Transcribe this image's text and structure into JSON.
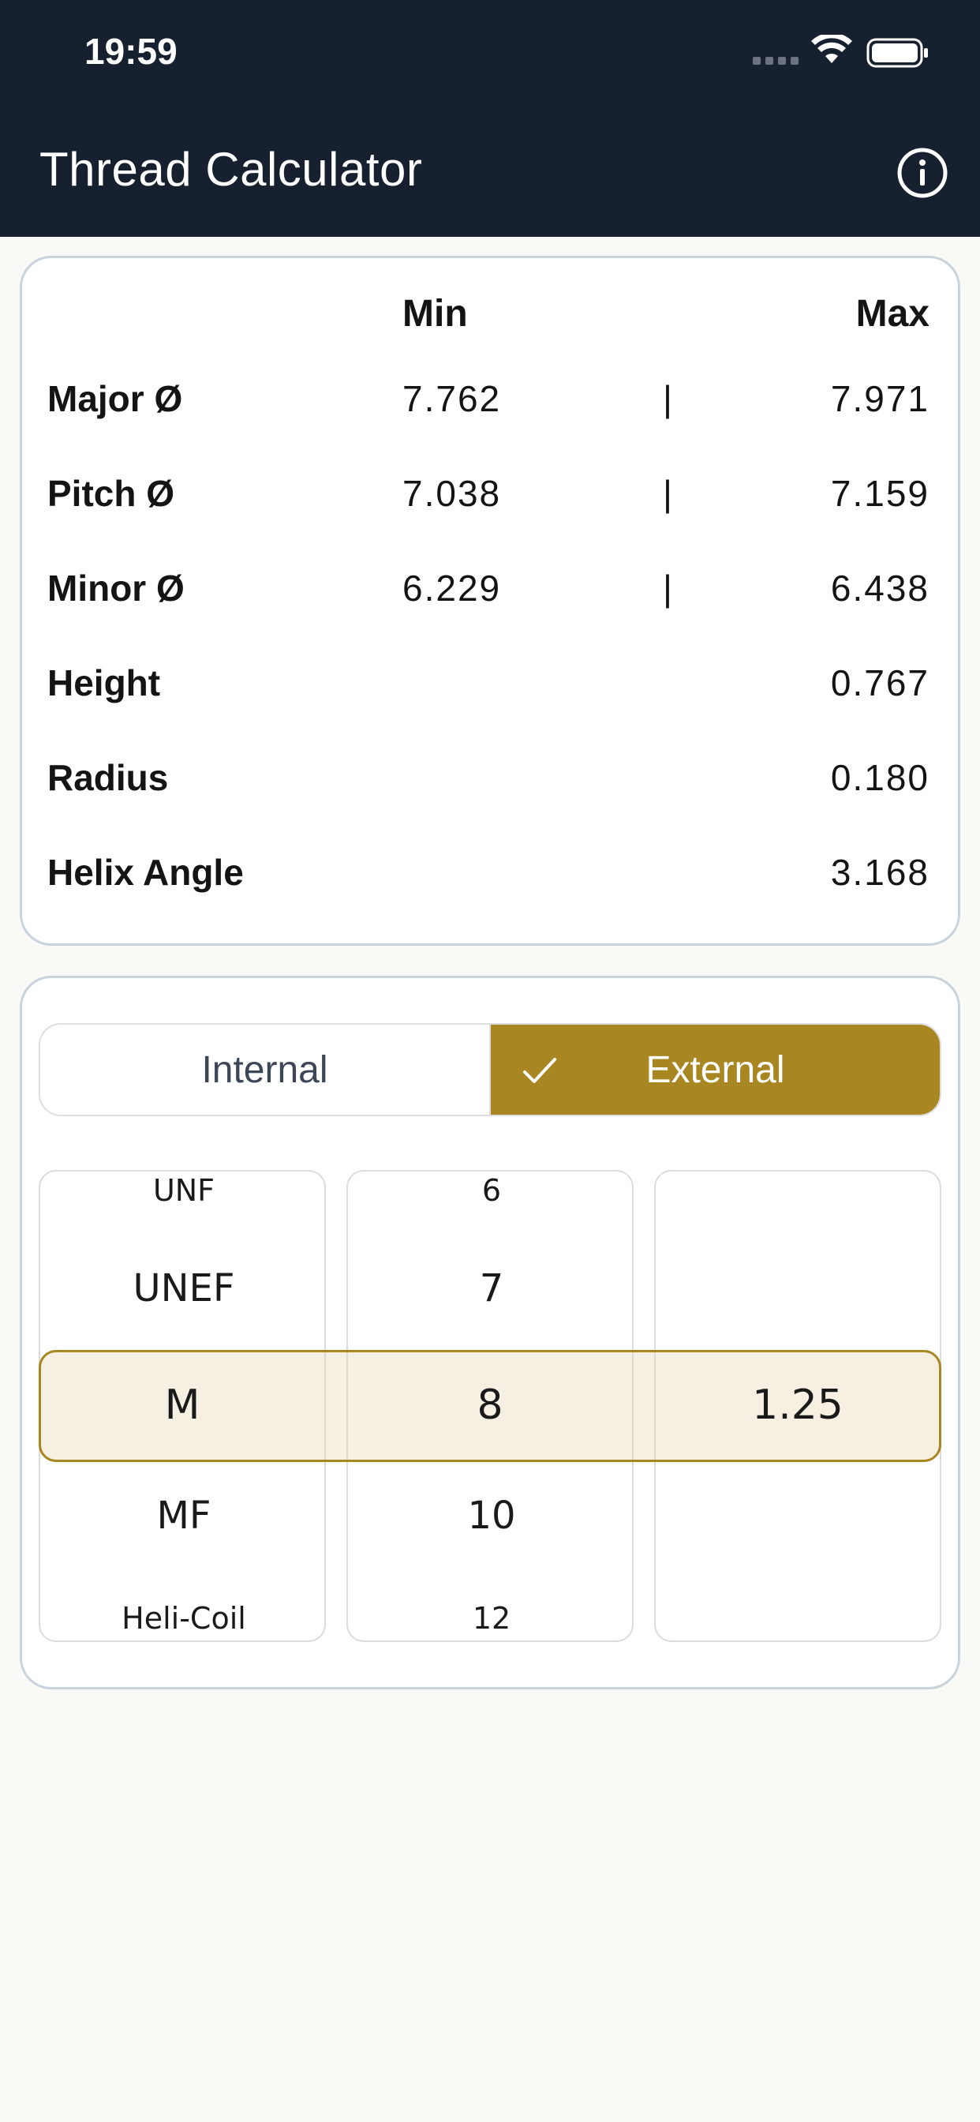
{
  "status_bar": {
    "time": "19:59"
  },
  "app": {
    "title": "Thread Calculator"
  },
  "results": {
    "header_min": "Min",
    "header_max": "Max",
    "separator": "|",
    "rows": [
      {
        "label": "Major Ø",
        "min": "7.762",
        "max": "7.971"
      },
      {
        "label": "Pitch Ø",
        "min": "7.038",
        "max": "7.159"
      },
      {
        "label": "Minor Ø",
        "min": "6.229",
        "max": "6.438"
      },
      {
        "label": "Height",
        "min": "",
        "max": "0.767"
      },
      {
        "label": "Radius",
        "min": "",
        "max": "0.180"
      },
      {
        "label": "Helix Angle",
        "min": "",
        "max": "3.168"
      }
    ]
  },
  "thread_type": {
    "options": [
      "Internal",
      "External"
    ],
    "selected": "External"
  },
  "pickers": {
    "standard": {
      "above_far": "UNF",
      "above": "UNEF",
      "selected": "M",
      "below": "MF",
      "below_far": "Heli-Coil"
    },
    "size": {
      "above_far": "6",
      "above": "7",
      "selected": "8",
      "below": "10",
      "below_far": "12"
    },
    "pitch": {
      "selected": "1.25"
    }
  },
  "colors": {
    "top_bar": "#16202e",
    "accent": "#a88622",
    "background": "#f9f9f5"
  }
}
